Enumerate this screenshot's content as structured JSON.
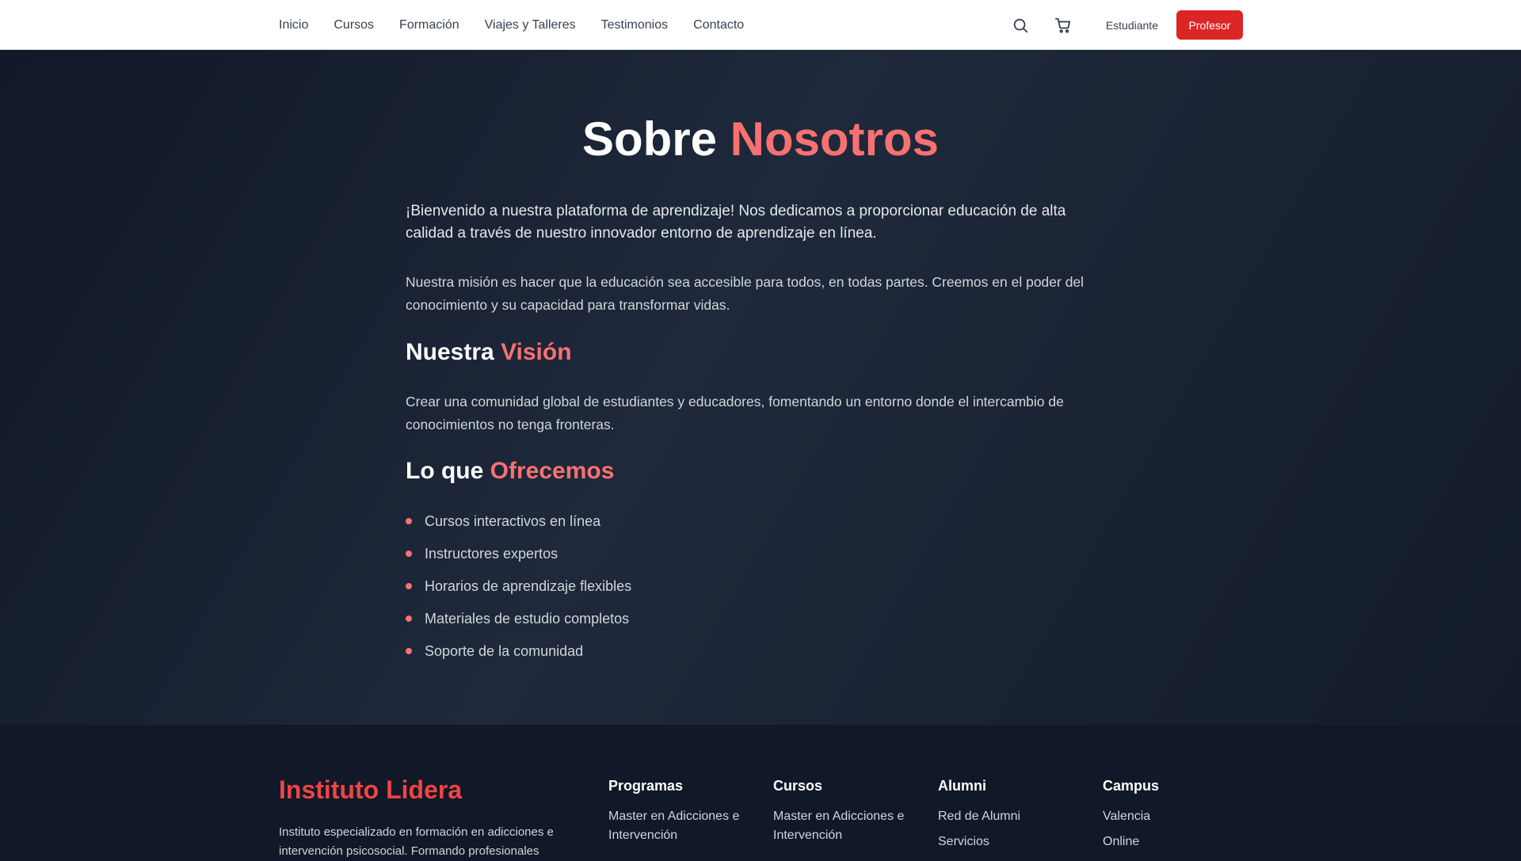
{
  "nav": {
    "items": [
      "Inicio",
      "Cursos",
      "Formación",
      "Viajes y Talleres",
      "Testimonios",
      "Contacto"
    ],
    "student_label": "Estudiante",
    "teacher_label": "Profesor"
  },
  "about": {
    "title_main": "Sobre",
    "title_accent": "Nosotros",
    "intro": "¡Bienvenido a nuestra plataforma de aprendizaje! Nos dedicamos a proporcionar educación de alta calidad a través de nuestro innovador entorno de aprendizaje en línea.",
    "mission": "Nuestra misión es hacer que la educación sea accesible para todos, en todas partes. Creemos en el poder del conocimiento y su capacidad para transformar vidas.",
    "vision_title_main": "Nuestra",
    "vision_title_accent": "Visión",
    "vision_text": "Crear una comunidad global de estudiantes y educadores, fomentando un entorno donde el intercambio de conocimientos no tenga fronteras.",
    "offer_title_main": "Lo que",
    "offer_title_accent": "Ofrecemos",
    "offer_items": [
      "Cursos interactivos en línea",
      "Instructores expertos",
      "Horarios de aprendizaje flexibles",
      "Materiales de estudio completos",
      "Soporte de la comunidad"
    ]
  },
  "footer": {
    "brand": "Instituto Lidera",
    "brand_desc": "Instituto especializado en formación en adicciones e intervención psicosocial. Formando profesionales",
    "columns": [
      {
        "title": "Programas",
        "items": [
          "Master en Adicciones e Intervención"
        ]
      },
      {
        "title": "Cursos",
        "items": [
          "Master en Adicciones e Intervención"
        ]
      },
      {
        "title": "Alumni",
        "items": [
          "Red de Alumni",
          "Servicios"
        ]
      },
      {
        "title": "Campus",
        "items": [
          "Valencia",
          "Online"
        ]
      }
    ]
  },
  "colors": {
    "accent": "#f87171",
    "brand_red": "#ef4444",
    "button_red": "#dc2626"
  },
  "icons": [
    "search-icon",
    "cart-icon"
  ]
}
